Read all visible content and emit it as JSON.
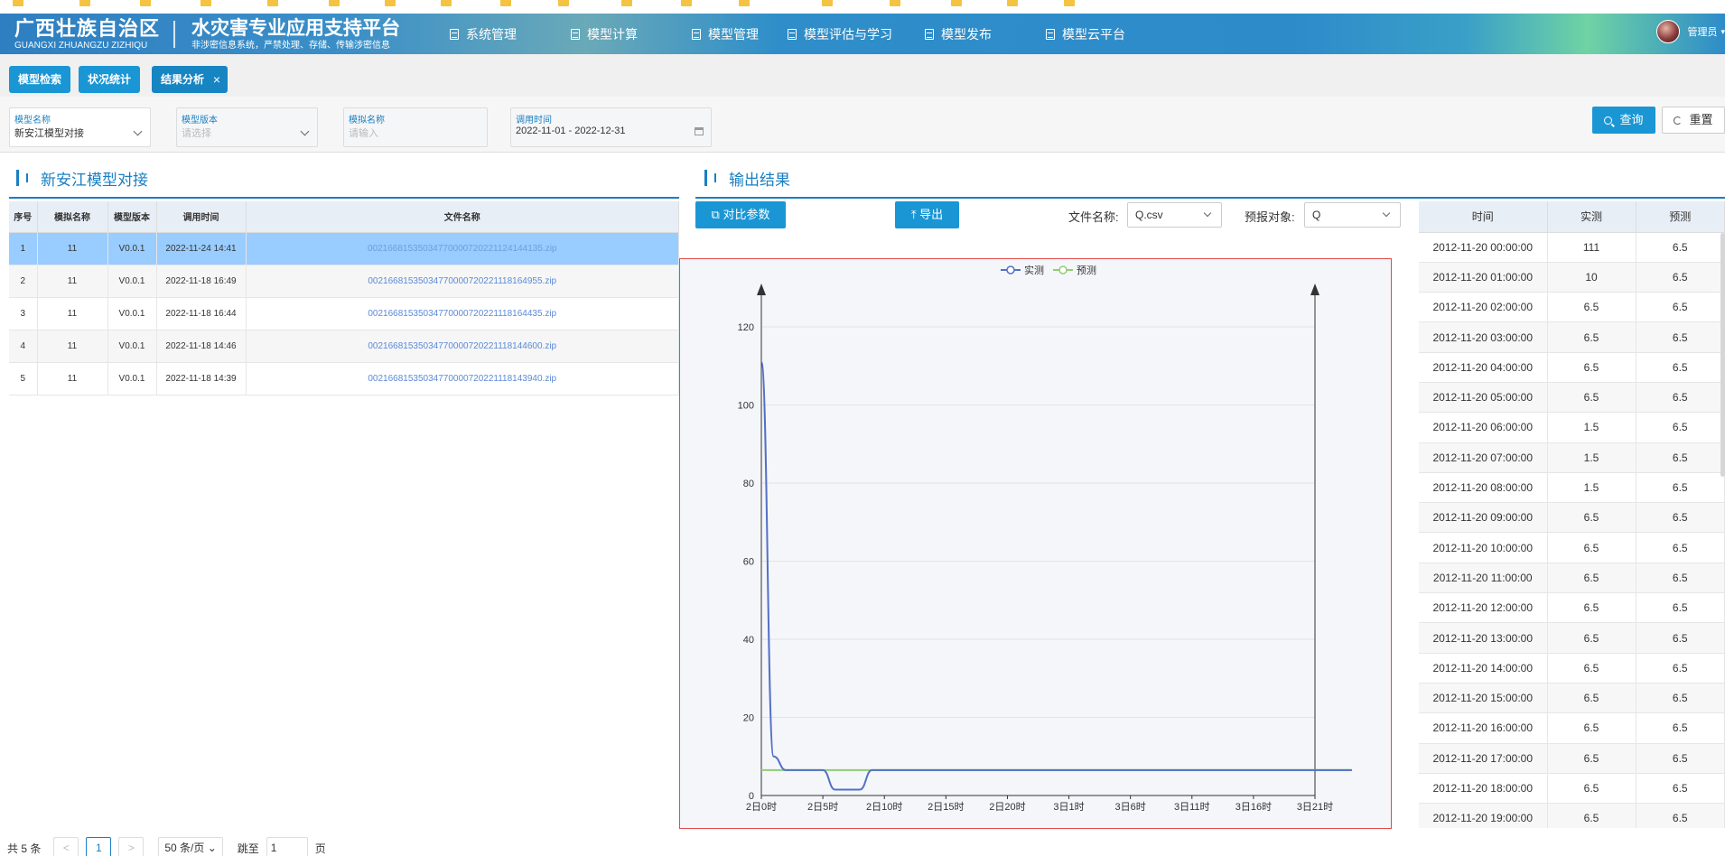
{
  "header": {
    "brand_cn": "广西壮族自治区",
    "brand_en": "GUANGXI ZHUANGZU ZIZHIQU",
    "platform_title": "水灾害专业应用支持平台",
    "platform_sub": "非涉密信息系统，严禁处理、存储、传输涉密信息",
    "nav": [
      {
        "label": "系统管理"
      },
      {
        "label": "模型计算"
      },
      {
        "label": "模型管理"
      },
      {
        "label": "模型评估与学习"
      },
      {
        "label": "模型发布"
      },
      {
        "label": "模型云平台"
      }
    ],
    "user": "管理员"
  },
  "tabs": [
    {
      "label": "模型检索"
    },
    {
      "label": "状况统计"
    },
    {
      "label": "结果分析",
      "close": "×"
    }
  ],
  "filters": {
    "model_name": {
      "label": "模型名称",
      "value": "新安江模型对接"
    },
    "model_version": {
      "label": "模型版本",
      "placeholder": "请选择"
    },
    "sim_name": {
      "label": "模拟名称",
      "placeholder": "请输入"
    },
    "call_time": {
      "label": "调用时间",
      "value": "2022-11-01 - 2022-12-31"
    },
    "query_label": "查询",
    "reset_label": "重置"
  },
  "left_panel": {
    "title": "新安江模型对接",
    "headers": [
      "序号",
      "模拟名称",
      "模型版本",
      "调用时间",
      "文件名称"
    ],
    "rows": [
      {
        "no": "1",
        "name": "11",
        "ver": "V0.0.1",
        "time": "2022-11-24 14:41",
        "file": "0021668153503477000072022112414413​5.zip"
      },
      {
        "no": "2",
        "name": "11",
        "ver": "V0.0.1",
        "time": "2022-11-18 16:49",
        "file": "0021668153503477000072022111816495​5.zip"
      },
      {
        "no": "3",
        "name": "11",
        "ver": "V0.0.1",
        "time": "2022-11-18 16:44",
        "file": "0021668153503477000072022111816443​5.zip"
      },
      {
        "no": "4",
        "name": "11",
        "ver": "V0.0.1",
        "time": "2022-11-18 14:46",
        "file": "0021668153503477000072022111814460​0.zip"
      },
      {
        "no": "5",
        "name": "11",
        "ver": "V0.0.1",
        "time": "2022-11-18 14:39",
        "file": "0021668153503477000072022111814394​0.zip"
      }
    ],
    "pager": {
      "total": "共 5 条",
      "prev": "<",
      "page": "1",
      "next": ">",
      "size": "50 条/页",
      "jump_label": "跳至",
      "jump_value": "1",
      "page_suffix": "页"
    }
  },
  "output": {
    "title": "输出结果",
    "compare_btn": "对比参数",
    "export_btn": "导出",
    "file_label": "文件名称:",
    "file_value": "Q.csv",
    "target_label": "预报对象:",
    "target_value": "Q"
  },
  "chart_data": {
    "type": "line",
    "x": [
      "2日0时",
      "2日5时",
      "2日10时",
      "2日15时",
      "2日20时",
      "3日1时",
      "3日6时",
      "3日11时",
      "3日16时",
      "3日21时"
    ],
    "ylim": [
      0,
      120
    ],
    "yticks": [
      0,
      20,
      40,
      60,
      80,
      100,
      120
    ],
    "legend_position": "top-center",
    "grid": true,
    "series": [
      {
        "name": "实测",
        "color": "#5470c6",
        "points": [
          [
            0,
            111
          ],
          [
            1,
            10
          ],
          [
            2,
            6.5
          ],
          [
            3,
            6.5
          ],
          [
            4,
            6.5
          ],
          [
            5,
            6.5
          ],
          [
            6,
            1.5
          ],
          [
            7,
            1.5
          ],
          [
            8,
            1.5
          ],
          [
            9,
            6.5
          ],
          [
            10,
            6.5
          ],
          [
            48,
            6.5
          ]
        ]
      },
      {
        "name": "预测",
        "color": "#91cc75",
        "points": [
          [
            0,
            6.5
          ],
          [
            48,
            6.5
          ]
        ]
      }
    ],
    "x_hours_per_tick": 5
  },
  "result_table": {
    "headers": [
      "时间",
      "实测",
      "预测"
    ],
    "rows": [
      [
        "2012-11-20 00:00:00",
        "111",
        "6.5"
      ],
      [
        "2012-11-20 01:00:00",
        "10",
        "6.5"
      ],
      [
        "2012-11-20 02:00:00",
        "6.5",
        "6.5"
      ],
      [
        "2012-11-20 03:00:00",
        "6.5",
        "6.5"
      ],
      [
        "2012-11-20 04:00:00",
        "6.5",
        "6.5"
      ],
      [
        "2012-11-20 05:00:00",
        "6.5",
        "6.5"
      ],
      [
        "2012-11-20 06:00:00",
        "1.5",
        "6.5"
      ],
      [
        "2012-11-20 07:00:00",
        "1.5",
        "6.5"
      ],
      [
        "2012-11-20 08:00:00",
        "1.5",
        "6.5"
      ],
      [
        "2012-11-20 09:00:00",
        "6.5",
        "6.5"
      ],
      [
        "2012-11-20 10:00:00",
        "6.5",
        "6.5"
      ],
      [
        "2012-11-20 11:00:00",
        "6.5",
        "6.5"
      ],
      [
        "2012-11-20 12:00:00",
        "6.5",
        "6.5"
      ],
      [
        "2012-11-20 13:00:00",
        "6.5",
        "6.5"
      ],
      [
        "2012-11-20 14:00:00",
        "6.5",
        "6.5"
      ],
      [
        "2012-11-20 15:00:00",
        "6.5",
        "6.5"
      ],
      [
        "2012-11-20 16:00:00",
        "6.5",
        "6.5"
      ],
      [
        "2012-11-20 17:00:00",
        "6.5",
        "6.5"
      ],
      [
        "2012-11-20 18:00:00",
        "6.5",
        "6.5"
      ],
      [
        "2012-11-20 19:00:00",
        "6.5",
        "6.5"
      ]
    ]
  }
}
